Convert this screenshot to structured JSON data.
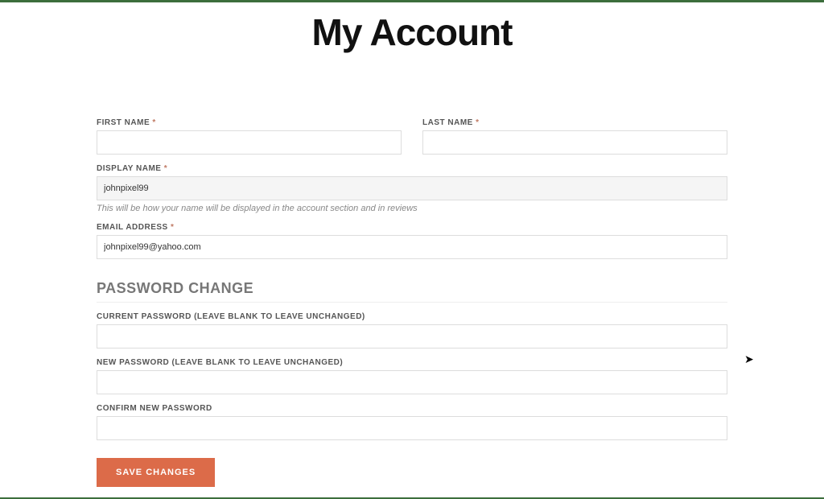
{
  "page": {
    "title": "My Account"
  },
  "labels": {
    "first_name": "FIRST NAME",
    "last_name": "LAST NAME",
    "display_name": "DISPLAY NAME",
    "email": "EMAIL ADDRESS",
    "current_pw": "CURRENT PASSWORD (LEAVE BLANK TO LEAVE UNCHANGED)",
    "new_pw": "NEW PASSWORD (LEAVE BLANK TO LEAVE UNCHANGED)",
    "confirm_pw": "CONFIRM NEW PASSWORD",
    "required": "*"
  },
  "values": {
    "first_name": "",
    "last_name": "",
    "display_name": "johnpixel99",
    "email": "johnpixel99@yahoo.com",
    "current_pw": "",
    "new_pw": "",
    "confirm_pw": ""
  },
  "hints": {
    "display_name": "This will be how your name will be displayed in the account section and in reviews"
  },
  "sections": {
    "password_change": "PASSWORD CHANGE"
  },
  "buttons": {
    "save": "SAVE CHANGES"
  }
}
